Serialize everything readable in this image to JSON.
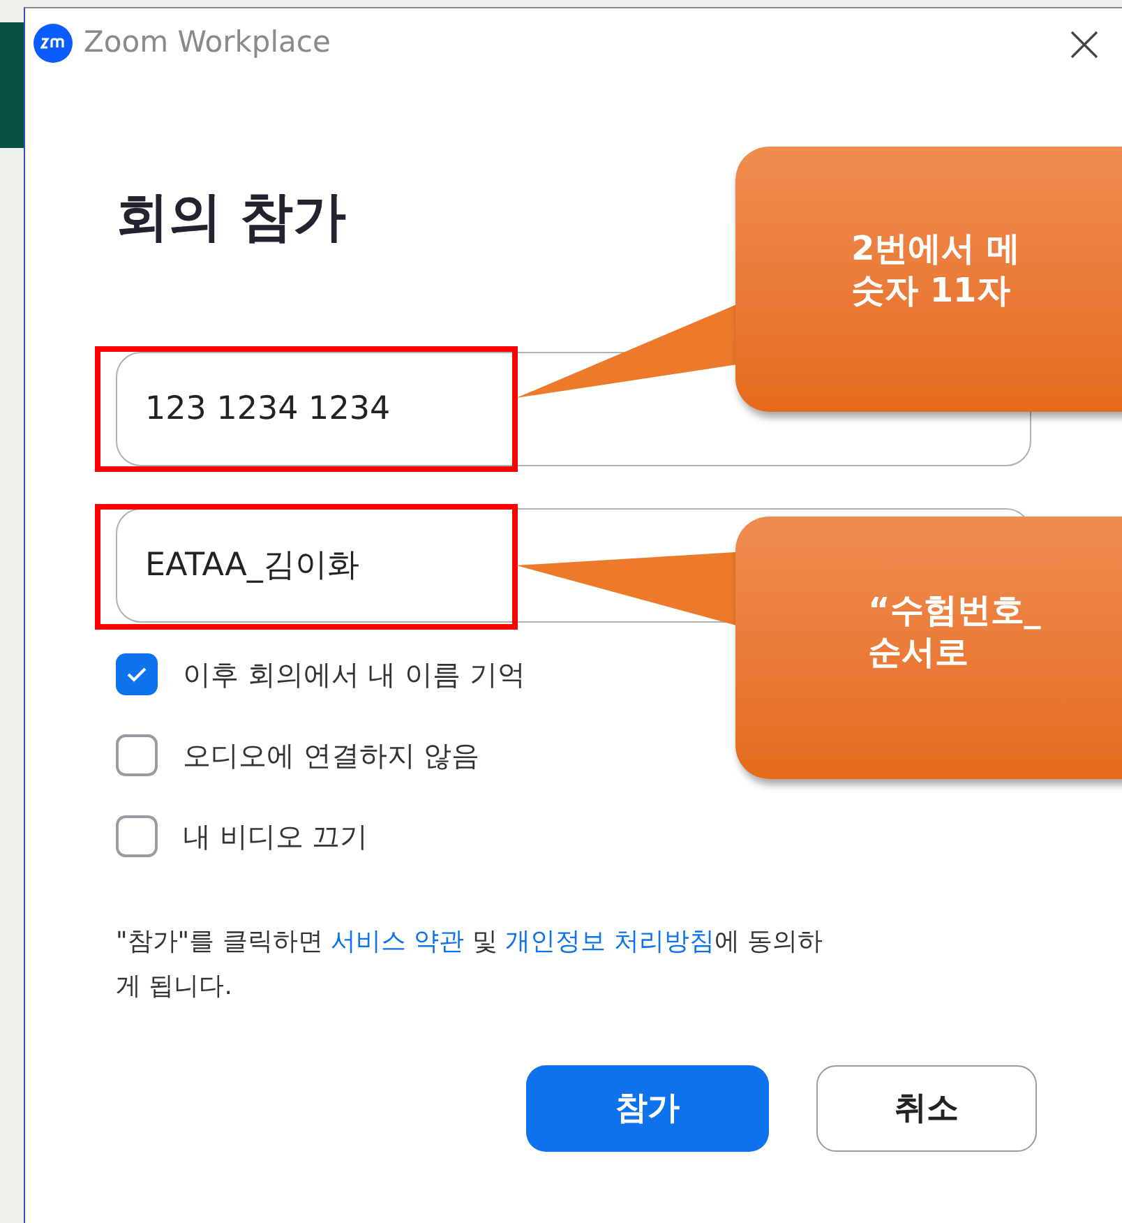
{
  "window": {
    "title": "Zoom Workplace"
  },
  "heading": "회의 참가",
  "meeting_id_field": {
    "value": "123 1234 1234"
  },
  "name_field": {
    "value": "EATAA_김이화"
  },
  "options": [
    {
      "label": "이후 회의에서 내 이름 기억",
      "checked": true
    },
    {
      "label": "오디오에 연결하지 않음",
      "checked": false
    },
    {
      "label": "내 비디오 끄기",
      "checked": false
    }
  ],
  "consent": [
    {
      "kind": "text",
      "text": "\"참가\"를 클릭하면 "
    },
    {
      "kind": "link",
      "text": "서비스 약관"
    },
    {
      "kind": "text",
      "text": " 및 "
    },
    {
      "kind": "link",
      "text": "개인정보 처리방침"
    },
    {
      "kind": "text",
      "text": "에 동의하게 됩니다."
    }
  ],
  "buttons": [
    {
      "label": "참가",
      "kind": "primary"
    },
    {
      "label": "취소",
      "kind": "secondary"
    }
  ],
  "callouts": [
    {
      "lines": [
        "2번에서 메",
        "숫자 11자"
      ]
    },
    {
      "lines": [
        "“수험번호_",
        "순서로"
      ]
    }
  ]
}
